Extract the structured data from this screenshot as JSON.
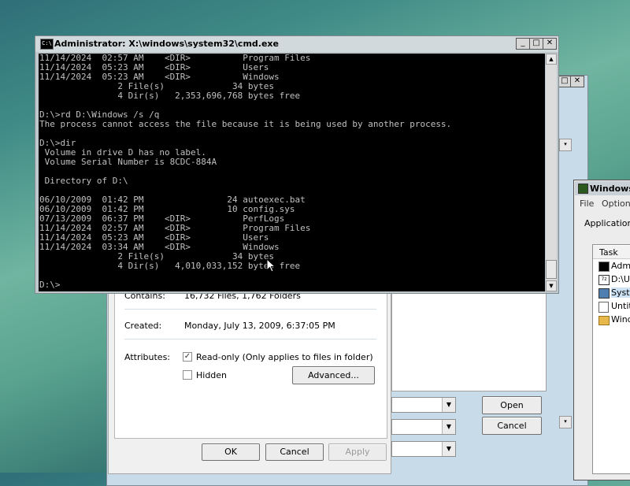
{
  "cmd_window": {
    "title": "Administrator: X:\\windows\\system32\\cmd.exe",
    "icon_label": "C:\\",
    "console_lines": [
      "11/14/2024  02:57 AM    <DIR>          Program Files",
      "11/14/2024  05:23 AM    <DIR>          Users",
      "11/14/2024  05:23 AM    <DIR>          Windows",
      "               2 File(s)             34 bytes",
      "               4 Dir(s)   2,353,696,768 bytes free",
      "",
      "D:\\>rd D:\\Windows /s /q",
      "The process cannot access the file because it is being used by another process.",
      "",
      "D:\\>dir",
      " Volume in drive D has no label.",
      " Volume Serial Number is 8CDC-884A",
      "",
      " Directory of D:\\",
      "",
      "06/10/2009  01:42 PM                24 autoexec.bat",
      "06/10/2009  01:42 PM                10 config.sys",
      "07/13/2009  06:37 PM    <DIR>          PerfLogs",
      "11/14/2024  02:57 AM    <DIR>          Program Files",
      "11/14/2024  05:23 AM    <DIR>          Users",
      "11/14/2024  03:34 AM    <DIR>          Windows",
      "               2 File(s)             34 bytes",
      "               4 Dir(s)   4,010,033,152 bytes free",
      "",
      "D:\\>"
    ],
    "minimize_glyph": "_",
    "maximize_glyph": "□",
    "close_glyph": "✕"
  },
  "properties_dialog": {
    "contains_label": "Contains:",
    "contains_value": "16,732 Files, 1,762 Folders",
    "created_label": "Created:",
    "created_value": "Monday, July 13, 2009, 6:37:05 PM",
    "attributes_label": "Attributes:",
    "readonly_label": "Read-only (Only applies to files in folder)",
    "readonly_check": "✓",
    "hidden_label": "Hidden",
    "advanced_button": "Advanced...",
    "ok_button": "OK",
    "cancel_button": "Cancel",
    "apply_button": "Apply"
  },
  "open_dialog": {
    "open_button": "Open",
    "cancel_button": "Cancel"
  },
  "task_manager": {
    "title": "Windows",
    "menu": [
      "File",
      "Options"
    ],
    "tab": "Applications",
    "column_header": "Task",
    "tasks": [
      "Admi",
      "D:\\Us",
      "Syste",
      "Untit",
      "Wind"
    ]
  },
  "back_window": {
    "close_glyph": "✕"
  }
}
